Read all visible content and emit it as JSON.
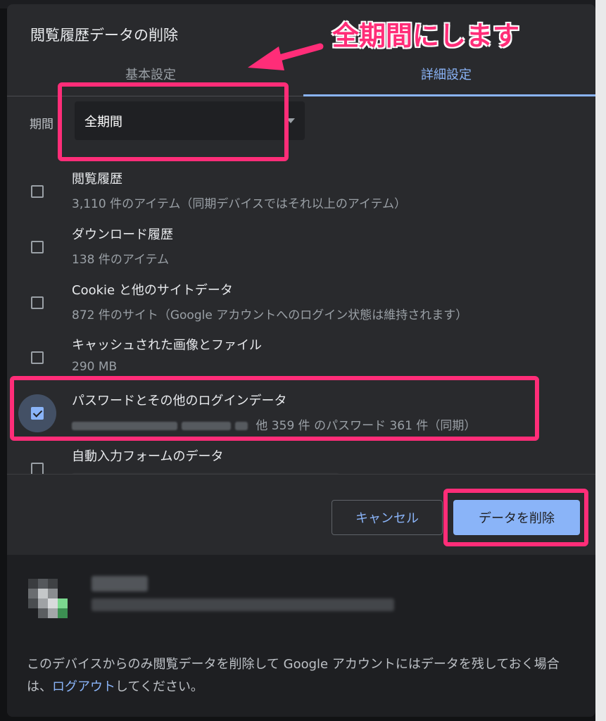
{
  "dialog": {
    "title": "閲覧履歴データの削除",
    "tabs": [
      {
        "label": "基本設定",
        "active": false
      },
      {
        "label": "詳細設定",
        "active": true
      }
    ],
    "period": {
      "label": "期間",
      "selected": "全期間"
    },
    "items": [
      {
        "title": "閲覧履歴",
        "subtitle": "3,110 件のアイテム（同期デバイスではそれ以上のアイテム）",
        "checked": false
      },
      {
        "title": "ダウンロード履歴",
        "subtitle": "138 件のアイテム",
        "checked": false
      },
      {
        "title": "Cookie と他のサイトデータ",
        "subtitle": "872 件のサイト（Google アカウントへのログイン状態は維持されます）",
        "checked": false
      },
      {
        "title": "キャッシュされた画像とファイル",
        "subtitle": "290 MB",
        "checked": false
      },
      {
        "title": "パスワードとその他のログインデータ",
        "subtitle": "他 359 件 のパスワード 361 件（同期）",
        "checked": true
      },
      {
        "title": "自動入力フォームのデータ",
        "subtitle": "",
        "checked": false
      }
    ],
    "buttons": {
      "cancel": "キャンセル",
      "delete": "データを削除"
    },
    "footer": {
      "text_before": "このデバイスからのみ閲覧データを削除して Google アカウントにはデータを残しておく場合は、",
      "link": "ログアウト",
      "text_after": "してください。"
    }
  },
  "annotation": {
    "text": "全期間にします"
  },
  "colors": {
    "accent": "#8ab4f8",
    "highlight": "#ff2d78",
    "dialog_bg": "#292a2d"
  }
}
